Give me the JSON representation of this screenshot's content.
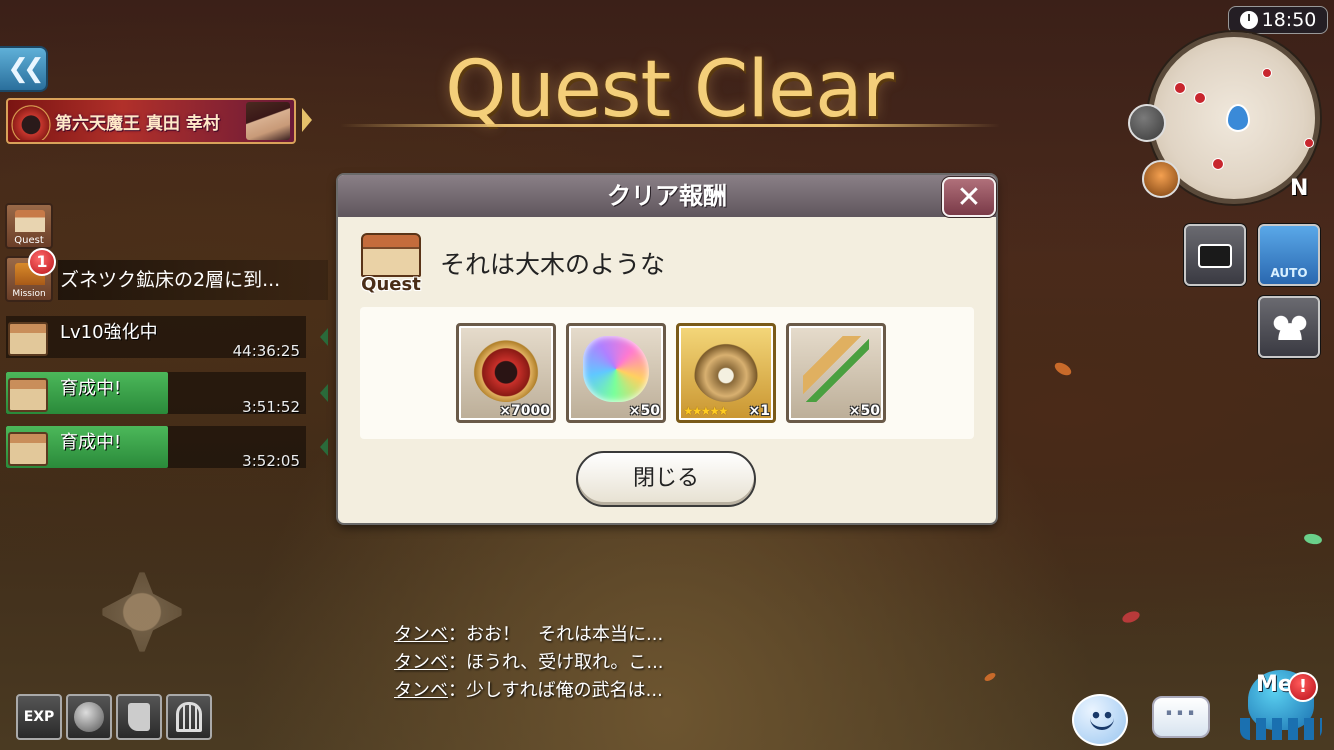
{
  "title": {
    "text": "Quest Clear"
  },
  "clock": {
    "time": "18:50",
    "icon": "clock-icon"
  },
  "nav": {
    "back_icon": "double-chevron-left-icon",
    "event_banner": {
      "title": "第六天魔王 真田 幸村"
    }
  },
  "side_panel": {
    "quest_icon_label": "Quest",
    "mission_icon_label": "Mission",
    "mission_badge": "1",
    "mission_text": "ズネツク鉱床の2層に到...",
    "tasks": [
      {
        "label": "Lv10強化中",
        "timer": "44:36:25",
        "progress": 0.0
      },
      {
        "label": "育成中!",
        "timer": "3:51:52",
        "progress": 0.5
      },
      {
        "label": "育成中!",
        "timer": "3:52:05",
        "progress": 0.5
      }
    ]
  },
  "dialog": {
    "header": "クリア報酬",
    "close_icon": "close-x-icon",
    "quest_icon_label": "Quest",
    "quest_name": "それは大木のような",
    "rewards": [
      {
        "name": "helmet-coin",
        "qty": "×7000",
        "stars": ""
      },
      {
        "name": "rainbow-crystal",
        "qty": "×50",
        "stars": ""
      },
      {
        "name": "gold-orb-relic",
        "qty": "×1",
        "stars": "★★★★★"
      },
      {
        "name": "rice-stalk",
        "qty": "×50",
        "stars": ""
      }
    ],
    "close_button": "閉じる"
  },
  "map": {
    "compass": "N",
    "auto_label": "AUTO"
  },
  "chat_log": [
    {
      "speaker": "タンベ",
      "text": "：おお！　それは本当に..."
    },
    {
      "speaker": "タンベ",
      "text": "：ほうれ、受け取れ。こ..."
    },
    {
      "speaker": "タンベ",
      "text": "：少しすれば俺の武名は..."
    }
  ],
  "bottom_left": {
    "exp_label": "EXP"
  },
  "bottom_right": {
    "chat_label": "···",
    "me_label": "Me",
    "me_alert": "!"
  },
  "colors": {
    "title_gold": "#f4cf7a",
    "dialog_bg": "#f3eedf",
    "task_green": "#3aa04a",
    "accent_blue": "#3a8ad8"
  }
}
